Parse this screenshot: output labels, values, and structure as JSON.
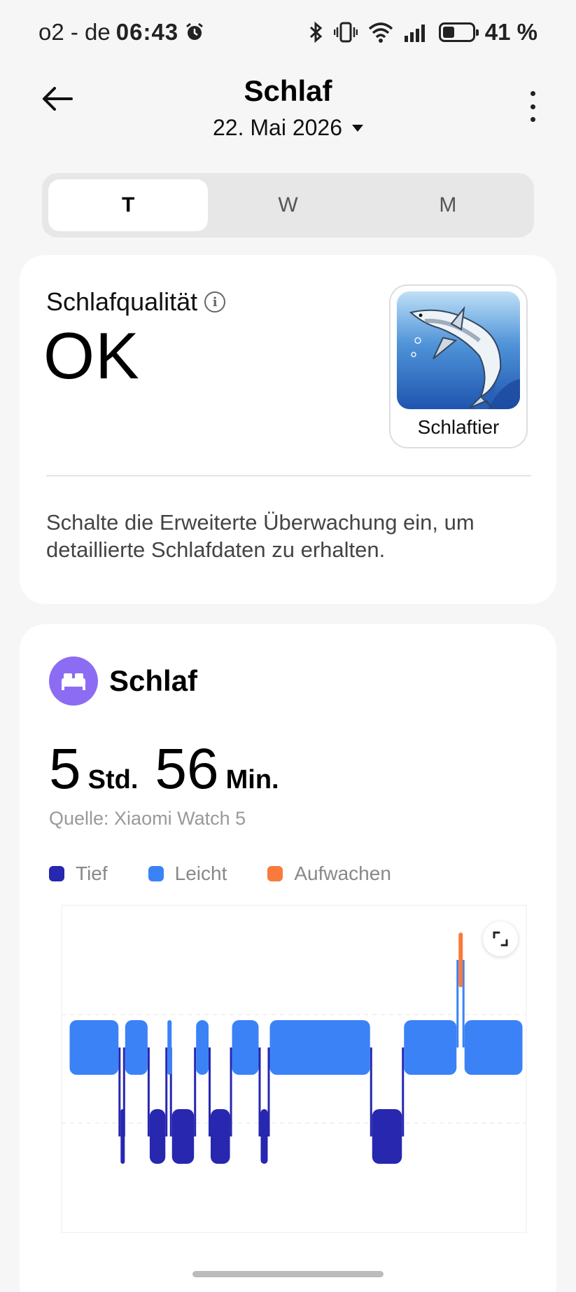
{
  "status_bar": {
    "carrier": "o2 - de",
    "time": "06:43",
    "battery_pct": "41 %",
    "battery_level": 0.41
  },
  "header": {
    "title": "Schlaf",
    "date": "22. Mai 2026"
  },
  "tabs": [
    {
      "label": "T",
      "active": true
    },
    {
      "label": "W",
      "active": false
    },
    {
      "label": "M",
      "active": false
    }
  ],
  "quality_card": {
    "label": "Schlafqualität",
    "value": "OK",
    "animal_label": "Schlaftier",
    "description": "Schalte die Erweiterte Überwachung ein, um detaillierte Schlafdaten zu erhalten."
  },
  "sleep_card": {
    "title": "Schlaf",
    "hours": "5",
    "hours_unit": "Std.",
    "minutes": "56",
    "minutes_unit": "Min.",
    "source": "Quelle: Xiaomi Watch 5",
    "legend": [
      {
        "label": "Tief",
        "color": "#2727b0"
      },
      {
        "label": "Leicht",
        "color": "#3b82f6"
      },
      {
        "label": "Aufwachen",
        "color": "#f97a3c"
      }
    ]
  },
  "chart_data": {
    "type": "sleep-stage-timeline",
    "stages": [
      "Aufwachen",
      "Leicht",
      "Tief"
    ],
    "colors": {
      "Aufwachen": "#f97a3c",
      "Leicht": "#3b82f6",
      "Tief": "#2727b0"
    },
    "time_range": [
      0,
      1000
    ],
    "segments": [
      {
        "stage": "Leicht",
        "start": 0,
        "end": 112
      },
      {
        "stage": "Tief",
        "start": 112,
        "end": 122
      },
      {
        "stage": "Leicht",
        "start": 122,
        "end": 176
      },
      {
        "stage": "Tief",
        "start": 176,
        "end": 215
      },
      {
        "stage": "Leicht",
        "start": 215,
        "end": 225
      },
      {
        "stage": "Tief",
        "start": 225,
        "end": 278
      },
      {
        "stage": "Leicht",
        "start": 278,
        "end": 310
      },
      {
        "stage": "Tief",
        "start": 310,
        "end": 357
      },
      {
        "stage": "Leicht",
        "start": 357,
        "end": 420
      },
      {
        "stage": "Tief",
        "start": 420,
        "end": 440
      },
      {
        "stage": "Leicht",
        "start": 440,
        "end": 665
      },
      {
        "stage": "Tief",
        "start": 665,
        "end": 735
      },
      {
        "stage": "Leicht",
        "start": 735,
        "end": 855
      },
      {
        "stage": "Aufwachen",
        "start": 855,
        "end": 868
      },
      {
        "stage": "Leicht",
        "start": 868,
        "end": 1000
      }
    ]
  }
}
